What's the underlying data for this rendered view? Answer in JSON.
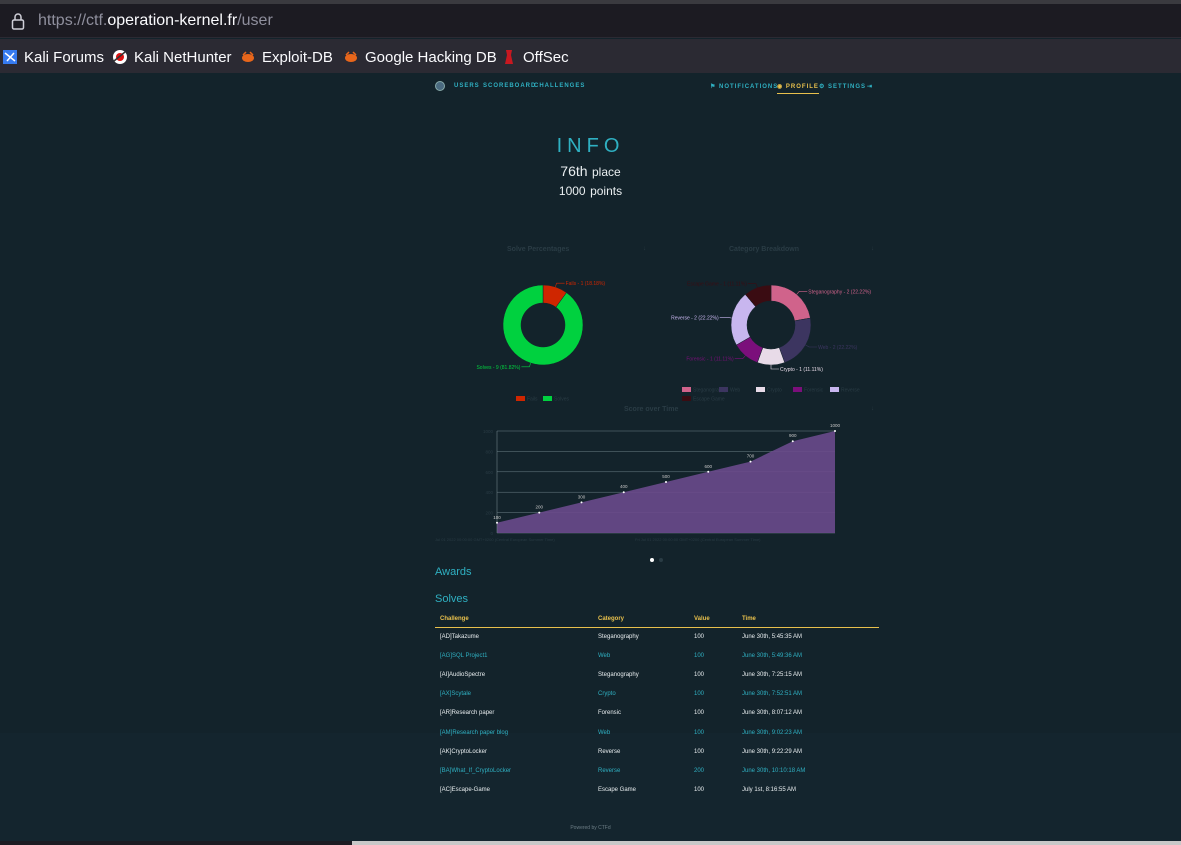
{
  "browser": {
    "url_prefix": "https://ctf.",
    "url_host": "operation-kernel.fr",
    "url_path": "/user",
    "bookmarks": [
      {
        "label": "Kali Forums",
        "icon": "kali-dragon-icon"
      },
      {
        "label": "Kali NetHunter",
        "icon": "nethunter-icon"
      },
      {
        "label": "Exploit-DB",
        "icon": "exploitdb-icon"
      },
      {
        "label": "Google Hacking DB",
        "icon": "ghdb-icon"
      },
      {
        "label": "OffSec",
        "icon": "offsec-icon"
      }
    ]
  },
  "nav": {
    "left": [
      "USERS",
      "SCOREBOARD",
      "CHALLENGES"
    ],
    "notifications": "NOTIFICATIONS",
    "profile": "PROFILE",
    "settings": "SETTINGS"
  },
  "info": {
    "title": "INFO",
    "place_value": "76th",
    "place_label": "place",
    "points_value": "1000",
    "points_label": "points"
  },
  "charts": {
    "solve_title": "Solve Percentages",
    "category_title": "Category Breakdown",
    "score_title": "Score over Time",
    "score_caption_left": "Jul 01 2022 00:00:00 GMT+0200 (Central European Summer Time)",
    "score_caption_right": "Fri Jul 01 2022 00:00:00 GMT+0200 (Central European Summer Time)"
  },
  "chart_data": [
    {
      "type": "pie",
      "title": "Solve Percentages",
      "labels": [
        "Fails",
        "Solves"
      ],
      "values": [
        1,
        9
      ],
      "slice_labels": [
        "Fails - 1 (18.18%)",
        "Solves - 9 (81.82%)"
      ],
      "colors": [
        "#cf2600",
        "#00d13f"
      ],
      "donut": true
    },
    {
      "type": "pie",
      "title": "Category Breakdown",
      "labels": [
        "Steganography",
        "Web",
        "Crypto",
        "Forensic",
        "Reverse",
        "Escape Game"
      ],
      "values": [
        2,
        2,
        1,
        1,
        2,
        1
      ],
      "slice_labels": [
        "Steganography - 2 (22.22%)",
        "Web - 2 (22.22%)",
        "Crypto - 1 (11.11%)",
        "Forensic - 1 (11.11%)",
        "Reverse - 2 (22.22%)",
        "Escape Game - 1 (11.11%)"
      ],
      "colors": [
        "#d0638b",
        "#3c3560",
        "#e8dbe8",
        "#7b0f7b",
        "#c8b6ef",
        "#3a0c12"
      ],
      "donut": true
    },
    {
      "type": "area",
      "title": "Score over Time",
      "x": [
        1,
        2,
        3,
        4,
        5,
        6,
        7,
        8,
        9
      ],
      "values": [
        100,
        200,
        300,
        400,
        500,
        600,
        700,
        900,
        1000
      ],
      "point_labels": [
        "100",
        "200",
        "300",
        "400",
        "500",
        "600",
        "700",
        "900",
        "1000"
      ],
      "ylim": [
        0,
        1000
      ],
      "y_ticks": [
        "1000",
        "800",
        "600",
        "400",
        "200",
        "0"
      ],
      "color": "#6a4a8c",
      "grid": true
    }
  ],
  "pager": {
    "active_color": "#ffffff"
  },
  "awards_label": "Awards",
  "solves_label": "Solves",
  "table": {
    "headers": [
      "Challenge",
      "Category",
      "Value",
      "Time"
    ],
    "rows": [
      [
        "[AD]Takazume",
        "Steganography",
        "100",
        "June 30th, 5:45:35 AM"
      ],
      [
        "[AG]SQL Project1",
        "Web",
        "100",
        "June 30th, 5:49:36 AM"
      ],
      [
        "[AI]AudioSpectre",
        "Steganography",
        "100",
        "June 30th, 7:25:15 AM"
      ],
      [
        "[AX]Scytale",
        "Crypto",
        "100",
        "June 30th, 7:52:51 AM"
      ],
      [
        "[AR]Research paper",
        "Forensic",
        "100",
        "June 30th, 8:07:12 AM"
      ],
      [
        "[AM]Research paper blog",
        "Web",
        "100",
        "June 30th, 9:02:23 AM"
      ],
      [
        "[AK]CryptoLocker",
        "Reverse",
        "100",
        "June 30th, 9:22:29 AM"
      ],
      [
        "[BA]What_If_CryptoLocker",
        "Reverse",
        "200",
        "June 30th, 10:10:18 AM"
      ],
      [
        "[AC]Escape-Game",
        "Escape Game",
        "100",
        "July 1st, 8:16:55 AM"
      ]
    ]
  },
  "footer": "Powered by CTFd"
}
